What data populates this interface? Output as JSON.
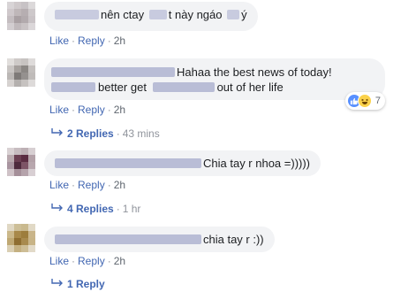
{
  "comments": [
    {
      "text": "nên ctay",
      "text2": "t này ngáo",
      "text3": "ý",
      "like_label": "Like",
      "reply_label": "Reply",
      "time": "2h"
    },
    {
      "text": "Hahaa the best news of today!",
      "text_line2a": "better get",
      "text_line2b": "out of her life",
      "like_label": "Like",
      "reply_label": "Reply",
      "time": "2h",
      "reaction_count": "7",
      "replies_label": "2 Replies",
      "replies_time": "43 mins"
    },
    {
      "text": "Chia tay r nhoa =)))))",
      "like_label": "Like",
      "reply_label": "Reply",
      "time": "2h",
      "replies_label": "4 Replies",
      "replies_time": "1 hr"
    },
    {
      "text": "chia tay r :))",
      "like_label": "Like",
      "reply_label": "Reply",
      "time": "2h",
      "replies_label": "1 Reply"
    }
  ],
  "separator": "·",
  "colors": {
    "link": "#4267b2",
    "bubble": "#f2f3f5",
    "meta": "#90949c"
  },
  "icons": {
    "reply_arrow": "reply-arrow-icon",
    "like_reaction": "like-reaction-icon",
    "haha_reaction": "haha-reaction-icon"
  }
}
